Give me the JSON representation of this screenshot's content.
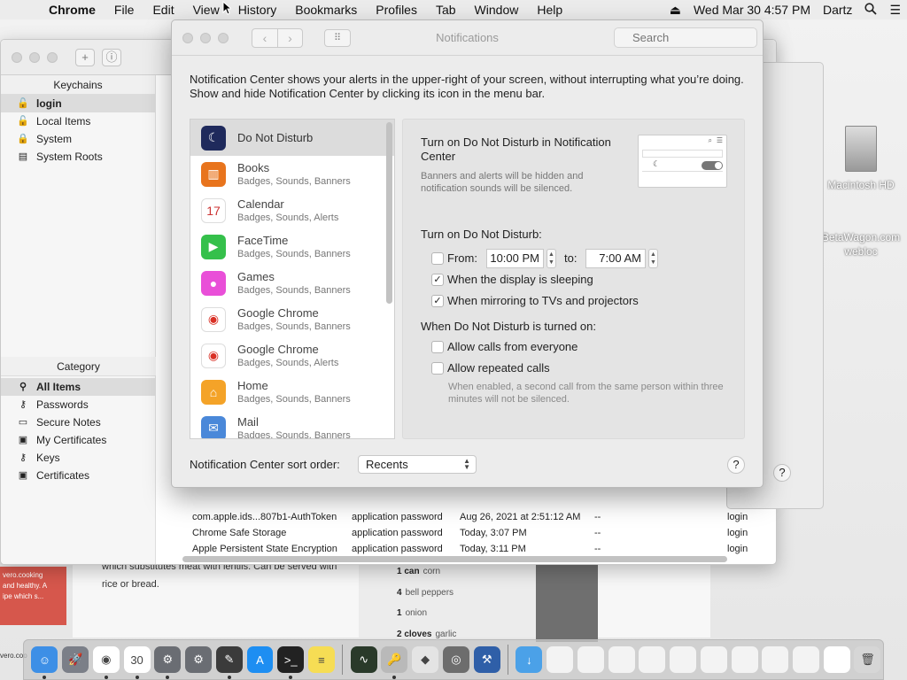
{
  "menubar": {
    "app": "Chrome",
    "items": [
      "File",
      "Edit",
      "View",
      "History",
      "Bookmarks",
      "Profiles",
      "Tab",
      "Window",
      "Help"
    ],
    "datetime": "Wed Mar 30  4:57 PM",
    "user": "Dartz"
  },
  "desktop": {
    "hd_label": "Macintosh HD",
    "webloc_label_1": "BetaWagon.com",
    "webloc_label_2": "webloc",
    "recipe_text": "which substitutes meat with lentils. Can be served with rice or bread.",
    "ingredients": [
      {
        "qty": "1 can",
        "item": "corn"
      },
      {
        "qty": "4",
        "item": "bell peppers"
      },
      {
        "qty": "1",
        "item": "onion"
      },
      {
        "qty": "2 cloves",
        "item": "garlic"
      }
    ],
    "red_card_lines": [
      "vero.cooking",
      "and healthy. A",
      "ipe which s..."
    ],
    "vero_label": "vero.coo"
  },
  "keychain": {
    "keychains_header": "Keychains",
    "keychains": [
      {
        "label": "login",
        "icon": "lock-open-icon",
        "selected": true
      },
      {
        "label": "Local Items",
        "icon": "lock-open-icon",
        "selected": false
      },
      {
        "label": "System",
        "icon": "lock-icon",
        "selected": false
      },
      {
        "label": "System Roots",
        "icon": "folder-icon",
        "selected": false
      }
    ],
    "category_header": "Category",
    "categories": [
      {
        "label": "All Items",
        "icon": "all-items-icon",
        "selected": true
      },
      {
        "label": "Passwords",
        "icon": "key-icon",
        "selected": false
      },
      {
        "label": "Secure Notes",
        "icon": "note-icon",
        "selected": false
      },
      {
        "label": "My Certificates",
        "icon": "certificate-icon",
        "selected": false
      },
      {
        "label": "Keys",
        "icon": "key-icon",
        "selected": false
      },
      {
        "label": "Certificates",
        "icon": "certificate-icon",
        "selected": false
      }
    ],
    "rows": [
      {
        "name": "com.apple.ids...807b1-AuthToken",
        "kind": "application password",
        "date": "Aug 26, 2021 at 2:51:12 AM",
        "expires": "--",
        "keychain": "login"
      },
      {
        "name": "Chrome Safe Storage",
        "kind": "application password",
        "date": "Today, 3:07 PM",
        "expires": "--",
        "keychain": "login"
      },
      {
        "name": "Apple Persistent State Encryption",
        "kind": "application password",
        "date": "Today, 3:11 PM",
        "expires": "--",
        "keychain": "login"
      }
    ]
  },
  "notifications": {
    "title": "Notifications",
    "search_placeholder": "Search",
    "description": "Notification Center shows your alerts in the upper-right of your screen, without interrupting what you’re doing. Show and hide Notification Center by clicking its icon in the menu bar.",
    "apps": [
      {
        "name": "Do Not Disturb",
        "sub": "",
        "icon": "moon-icon",
        "color": "#1f2a5c",
        "selected": true
      },
      {
        "name": "Books",
        "sub": "Badges, Sounds, Banners",
        "icon": "book-icon",
        "color": "#e8741d",
        "selected": false
      },
      {
        "name": "Calendar",
        "sub": "Badges, Sounds, Alerts",
        "icon": "calendar-icon",
        "color": "#ffffff",
        "selected": false
      },
      {
        "name": "FaceTime",
        "sub": "Badges, Sounds, Banners",
        "icon": "video-camera-icon",
        "color": "#35c04b",
        "selected": false
      },
      {
        "name": "Games",
        "sub": "Badges, Sounds, Banners",
        "icon": "game-bubbles-icon",
        "color": "#e94fd8",
        "selected": false
      },
      {
        "name": "Google Chrome",
        "sub": "Badges, Sounds, Banners",
        "icon": "chrome-icon",
        "color": "#ffffff",
        "selected": false
      },
      {
        "name": "Google Chrome",
        "sub": "Badges, Sounds, Alerts",
        "icon": "chrome-icon",
        "color": "#ffffff",
        "selected": false
      },
      {
        "name": "Home",
        "sub": "Badges, Sounds, Banners",
        "icon": "house-icon",
        "color": "#f4a328",
        "selected": false
      },
      {
        "name": "Mail",
        "sub": "Badges, Sounds, Banners",
        "icon": "mail-icon",
        "color": "#4a88d9",
        "selected": false
      }
    ],
    "dnd": {
      "heading": "Turn on Do Not Disturb in Notification Center",
      "subtext": "Banners and alerts will be hidden and notification sounds will be silenced.",
      "turn_on_label": "Turn on Do Not Disturb:",
      "from_label": "From:",
      "from_time": "10:00 PM",
      "to_label": "to:",
      "to_time": "7:00 AM",
      "from_checked": false,
      "display_sleeping_label": "When the display is sleeping",
      "display_sleeping_checked": true,
      "mirroring_label": "When mirroring to TVs and projectors",
      "mirroring_checked": true,
      "when_on_label": "When Do Not Disturb is turned on:",
      "allow_calls_label": "Allow calls from everyone",
      "allow_calls_checked": false,
      "repeated_calls_label": "Allow repeated calls",
      "repeated_calls_checked": false,
      "repeated_note": "When enabled, a second call from the same person within three minutes will not be silenced."
    },
    "sort_label": "Notification Center sort order:",
    "sort_value": "Recents",
    "help": "?"
  },
  "dock": {
    "icons": [
      {
        "name": "finder-icon",
        "color": "#3d8fe6",
        "glyph": "☺",
        "running": true
      },
      {
        "name": "launchpad-icon",
        "color": "#7b7f88",
        "glyph": "🚀",
        "running": false
      },
      {
        "name": "chrome-dock-icon",
        "color": "#ffffff",
        "glyph": "◉",
        "running": true
      },
      {
        "name": "calendar-dock-icon",
        "color": "#ffffff",
        "glyph": "30",
        "running": true
      },
      {
        "name": "system-preferences-icon",
        "color": "#6a6d73",
        "glyph": "⚙",
        "running": true
      },
      {
        "name": "system-preferences-2-icon",
        "color": "#6a6d73",
        "glyph": "⚙",
        "running": false
      },
      {
        "name": "pixelmator-icon",
        "color": "#3b3b3b",
        "glyph": "✎",
        "running": true
      },
      {
        "name": "app-store-icon",
        "color": "#1d8ef2",
        "glyph": "A",
        "running": false
      },
      {
        "name": "terminal-icon",
        "color": "#222222",
        "glyph": ">_",
        "running": true
      },
      {
        "name": "notes-icon",
        "color": "#f6dd54",
        "glyph": "≡",
        "running": false
      },
      {
        "name": "activity-monitor-icon",
        "color": "#2a3a2a",
        "glyph": "∿",
        "running": false
      },
      {
        "name": "keychain-access-icon",
        "color": "#b9b9b9",
        "glyph": "🔑",
        "running": true
      },
      {
        "name": "colorsync-icon",
        "color": "#e4e4e4",
        "glyph": "◆",
        "running": false
      },
      {
        "name": "screenshot-icon",
        "color": "#6d6d6d",
        "glyph": "◎",
        "running": false
      },
      {
        "name": "xcode-icon",
        "color": "#2f5fa8",
        "glyph": "⚒",
        "running": false
      },
      {
        "name": "downloads-folder-icon",
        "color": "#4ba1e8",
        "glyph": "↓",
        "running": false
      },
      {
        "name": "doc-thumb-1-icon",
        "color": "#f3f3f3",
        "glyph": "",
        "running": false
      },
      {
        "name": "doc-thumb-2-icon",
        "color": "#f3f3f3",
        "glyph": "",
        "running": false
      },
      {
        "name": "doc-thumb-3-icon",
        "color": "#f3f3f3",
        "glyph": "",
        "running": false
      },
      {
        "name": "doc-thumb-4-icon",
        "color": "#f3f3f3",
        "glyph": "",
        "running": false
      },
      {
        "name": "doc-thumb-5-icon",
        "color": "#f3f3f3",
        "glyph": "",
        "running": false
      },
      {
        "name": "doc-thumb-6-icon",
        "color": "#f3f3f3",
        "glyph": "",
        "running": false
      },
      {
        "name": "doc-thumb-7-icon",
        "color": "#f3f3f3",
        "glyph": "",
        "running": false
      },
      {
        "name": "doc-thumb-8-icon",
        "color": "#f3f3f3",
        "glyph": "",
        "running": false
      },
      {
        "name": "doc-thumb-9-icon",
        "color": "#f3f3f3",
        "glyph": "",
        "running": false
      },
      {
        "name": "window-thumb-icon",
        "color": "#ffffff",
        "glyph": "",
        "running": false
      },
      {
        "name": "trash-icon",
        "color": "#d6d6d6",
        "glyph": "🗑",
        "running": false
      }
    ]
  }
}
